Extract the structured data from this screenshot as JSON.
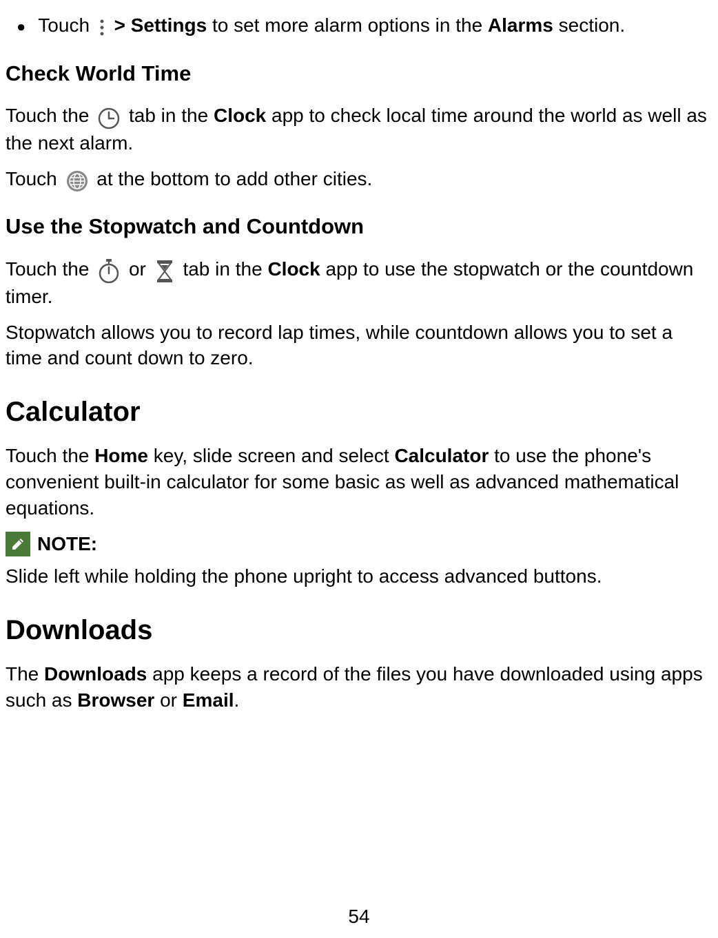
{
  "bullet": {
    "text_before_icon": "Touch ",
    "text_after_icon": " ",
    "bold_part": "> Settings",
    "text_after_bold1": " to set more alarm options in the ",
    "bold_part2": "Alarms",
    "text_after_bold2": " section."
  },
  "world_time": {
    "title": "Check World Time",
    "p1_before": "Touch the ",
    "p1_after_icon": " tab in the ",
    "p1_bold": "Clock",
    "p1_after_bold": " app to check local time around the world as well as the next alarm.",
    "p2_before": "Touch ",
    "p2_after": " at the bottom to add other cities."
  },
  "stopwatch": {
    "title": "Use the Stopwatch and Countdown",
    "p1_before": "Touch the ",
    "p1_or": " or ",
    "p1_after_icons": " tab in the ",
    "p1_bold": "Clock",
    "p1_after_bold": " app to use the stopwatch or the countdown timer.",
    "p2": "Stopwatch allows you to record lap times, while countdown allows you to set a time and count down to zero."
  },
  "calculator": {
    "title": "Calculator",
    "p1_before": "Touch the ",
    "p1_bold1": "Home",
    "p1_mid": " key, slide screen and select ",
    "p1_bold2": "Calculator",
    "p1_after": " to use the phone's convenient built-in calculator for some basic as well as advanced mathematical equations.",
    "note_label": " NOTE:",
    "note_text": "Slide left while holding the phone upright to access advanced buttons."
  },
  "downloads": {
    "title": "Downloads",
    "p1_before": "The ",
    "p1_bold1": "Downloads",
    "p1_mid": " app keeps a record of the files you have downloaded using apps such as ",
    "p1_bold2": "Browser",
    "p1_or": " or ",
    "p1_bold3": "Email",
    "p1_after": "."
  },
  "page_number": "54"
}
